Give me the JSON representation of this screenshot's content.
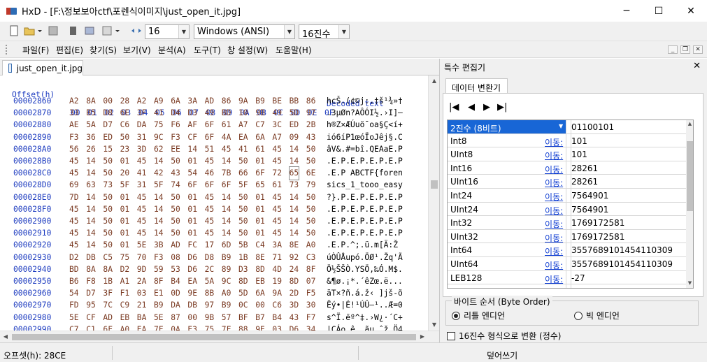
{
  "window": {
    "app_name": "HxD",
    "title": "HxD - [F:\\정보보아ctf\\포렌식이미지\\just_open_it.jpg]",
    "minimize": "─",
    "maximize": "☐",
    "close": "✕"
  },
  "toolbar": {
    "bytes_per_row": "16",
    "charset": "Windows (ANSI)",
    "offset_base": "16진수"
  },
  "menu": {
    "items": [
      "파일(F)",
      "편집(E)",
      "찾기(S)",
      "보기(V)",
      "분석(A)",
      "도구(T)",
      "창 설정(W)",
      "도움말(H)"
    ]
  },
  "file_tab": {
    "label": "just_open_it.jpg"
  },
  "hex_view": {
    "header_offset": "Offset(h)",
    "header_columns": [
      "00",
      "01",
      "02",
      "03",
      "04",
      "05",
      "06",
      "07",
      "08",
      "09",
      "0A",
      "0B",
      "0C",
      "0D",
      "0E",
      "0F"
    ],
    "header_decoded": "Decoded text",
    "rows": [
      {
        "offset": "00002860",
        "bytes": [
          "A2",
          "8A",
          "00",
          "28",
          "A2",
          "A9",
          "6A",
          "3A",
          "AD",
          "86",
          "9A",
          "B9",
          "BE",
          "BB",
          "86"
        ],
        "text": "hcŠ.(¢©j:.†š¹¾»†"
      },
      {
        "offset": "00002870",
        "bytes": [
          "33",
          "B5",
          "D8",
          "6E",
          "3F",
          "41",
          "D4",
          "D3",
          "49",
          "BD",
          "10",
          "9B",
          "49",
          "5D",
          "97"
        ],
        "text": ".3µØn?AÔÓI½.›I]—"
      },
      {
        "offset": "00002880",
        "bytes": [
          "AE",
          "5A",
          "D7",
          "C6",
          "DA",
          "75",
          "F6",
          "AF",
          "6F",
          "61",
          "A7",
          "C7",
          "3C",
          "ED",
          "2B"
        ],
        "text": "h®Z×ÆÚuö¯oa§Ç<í+"
      },
      {
        "offset": "00002890",
        "bytes": [
          "F3",
          "36",
          "ED",
          "50",
          "31",
          "9C",
          "F3",
          "CF",
          "6F",
          "4A",
          "EA",
          "6A",
          "A7",
          "09",
          "43"
        ],
        "text": "ió6íP1œóÏoJêj§.C"
      },
      {
        "offset": "000028A0",
        "bytes": [
          "56",
          "26",
          "15",
          "23",
          "3D",
          "62",
          "EE",
          "14",
          "51",
          "45",
          "41",
          "61",
          "45",
          "14",
          "50"
        ],
        "text": "âV&.#=bî.QEAaE.P"
      },
      {
        "offset": "000028B0",
        "bytes": [
          "45",
          "14",
          "50",
          "01",
          "45",
          "14",
          "50",
          "01",
          "45",
          "14",
          "50",
          "01",
          "45",
          "14",
          "50"
        ],
        "text": ".E.P.E.P.E.P.E.P"
      },
      {
        "offset": "000028C0",
        "bytes": [
          "45",
          "14",
          "50",
          "20",
          "41",
          "42",
          "43",
          "54",
          "46",
          "7B",
          "66",
          "6F",
          "72",
          "65",
          "6E"
        ],
        "text": ".E.P ABCTF{foren"
      },
      {
        "offset": "000028D0",
        "bytes": [
          "69",
          "63",
          "73",
          "5F",
          "31",
          "5F",
          "74",
          "6F",
          "6F",
          "6F",
          "5F",
          "65",
          "61",
          "73",
          "79"
        ],
        "text": "sics_1_tooo_easy"
      },
      {
        "offset": "000028E0",
        "bytes": [
          "7D",
          "14",
          "50",
          "01",
          "45",
          "14",
          "50",
          "01",
          "45",
          "14",
          "50",
          "01",
          "45",
          "14",
          "50"
        ],
        "text": "?}.P.E.P.E.P.E.P"
      },
      {
        "offset": "000028F0",
        "bytes": [
          "45",
          "14",
          "50",
          "01",
          "45",
          "14",
          "50",
          "01",
          "45",
          "14",
          "50",
          "01",
          "45",
          "14",
          "50"
        ],
        "text": ".E.P.E.P.E.P.E.P"
      },
      {
        "offset": "00002900",
        "bytes": [
          "45",
          "14",
          "50",
          "01",
          "45",
          "14",
          "50",
          "01",
          "45",
          "14",
          "50",
          "01",
          "45",
          "14",
          "50"
        ],
        "text": ".E.P.E.P.E.P.E.P"
      },
      {
        "offset": "00002910",
        "bytes": [
          "45",
          "14",
          "50",
          "01",
          "45",
          "14",
          "50",
          "01",
          "45",
          "14",
          "50",
          "01",
          "45",
          "14",
          "50"
        ],
        "text": ".E.P.E.P.E.P.E.P"
      },
      {
        "offset": "00002920",
        "bytes": [
          "45",
          "14",
          "50",
          "01",
          "5E",
          "3B",
          "AD",
          "FC",
          "17",
          "6D",
          "5B",
          "C4",
          "3A",
          "8E",
          "A0"
        ],
        "text": ".E.P.^;.ü.m[Ä:Ž "
      },
      {
        "offset": "00002930",
        "bytes": [
          "D2",
          "DB",
          "C5",
          "75",
          "70",
          "F3",
          "08",
          "D6",
          "D8",
          "B9",
          "1B",
          "8E",
          "71",
          "92",
          "C3"
        ],
        "text": "úÒÛÅupó.ÖØ¹.Žq'Ã"
      },
      {
        "offset": "00002940",
        "bytes": [
          "BD",
          "8A",
          "8A",
          "D2",
          "9D",
          "59",
          "53",
          "D6",
          "2C",
          "89",
          "D3",
          "8D",
          "4D",
          "24",
          "8F"
        ],
        "text": "Ö½ŠŠÒ.YSÖ,‰Ó.M$."
      },
      {
        "offset": "00002950",
        "bytes": [
          "B6",
          "F8",
          "1B",
          "A1",
          "2A",
          "8F",
          "B4",
          "EA",
          "5A",
          "9C",
          "8D",
          "EB",
          "19",
          "8D",
          "07"
        ],
        "text": "&¶ø.¡*.´êZœ.ë..."
      },
      {
        "offset": "00002960",
        "bytes": [
          "54",
          "D7",
          "3F",
          "F1",
          "03",
          "E1",
          "0D",
          "9E",
          "8B",
          "A0",
          "5D",
          "6A",
          "9A",
          "2D",
          "F5"
        ],
        "text": "äT×?ñ.á.ž‹ ]jš-õ"
      },
      {
        "offset": "00002970",
        "bytes": [
          "FD",
          "95",
          "7C",
          "C9",
          "21",
          "B9",
          "DA",
          "DB",
          "97",
          "B9",
          "0C",
          "00",
          "C6",
          "3D",
          "30"
        ],
        "text": "Ëý•|É!¹ÚÛ—¹..Æ=0"
      },
      {
        "offset": "00002980",
        "bytes": [
          "5E",
          "CF",
          "AD",
          "EB",
          "BA",
          "5E",
          "87",
          "00",
          "9B",
          "57",
          "BF",
          "B7",
          "B4",
          "43",
          "F7"
        ],
        "text": "s^Ï.ëº^‡.›W¿·´C÷"
      },
      {
        "offset": "00002990",
        "bytes": [
          "C7",
          "C1",
          "6F",
          "A0",
          "EA",
          "7F",
          "0A",
          "E3",
          "75",
          "7F",
          "88",
          "9E",
          "03",
          "D6",
          "34"
        ],
        "text": "|ÇÁo ê..ãu.ˆž.Ö4"
      },
      {
        "offset": "000029A0",
        "bytes": [
          "F4",
          "EB",
          "ED",
          "51",
          "A4",
          "B5",
          "B8",
          "5D",
          "92",
          "01",
          "04",
          "E9",
          "91",
          "F5",
          "0A"
        ],
        "text": "ùôëíQ¤µ¸]'..é'õ."
      }
    ]
  },
  "special_editor": {
    "title": "특수 편집기",
    "close": "✕",
    "tab_label": "데이터 변환기",
    "nav": [
      "|◀",
      "◀",
      "▶",
      "▶|"
    ],
    "move_label": "이동:",
    "rows": [
      {
        "name": "2진수 (8비트)",
        "value": "01100101",
        "selected": true
      },
      {
        "name": "Int8",
        "value": "101"
      },
      {
        "name": "UInt8",
        "value": "101"
      },
      {
        "name": "Int16",
        "value": "28261"
      },
      {
        "name": "UInt16",
        "value": "28261"
      },
      {
        "name": "Int24",
        "value": "7564901"
      },
      {
        "name": "UInt24",
        "value": "7564901"
      },
      {
        "name": "Int32",
        "value": "1769172581"
      },
      {
        "name": "UInt32",
        "value": "1769172581"
      },
      {
        "name": "Int64",
        "value": "3557689101454110309"
      },
      {
        "name": "UInt64",
        "value": "3557689101454110309"
      },
      {
        "name": "LEB128",
        "value": "-27"
      },
      {
        "name": "ULEB128",
        "value": "101"
      }
    ],
    "byte_order_legend": "바이트 순서 (Byte Order)",
    "little_endian": "리틀 엔디언",
    "big_endian": "빅 엔디언",
    "hex_checkbox": "16진수 형식으로 변환 (정수)"
  },
  "status": {
    "offset": "오프셋(h): 28CE",
    "mode": "덮어쓰기"
  }
}
